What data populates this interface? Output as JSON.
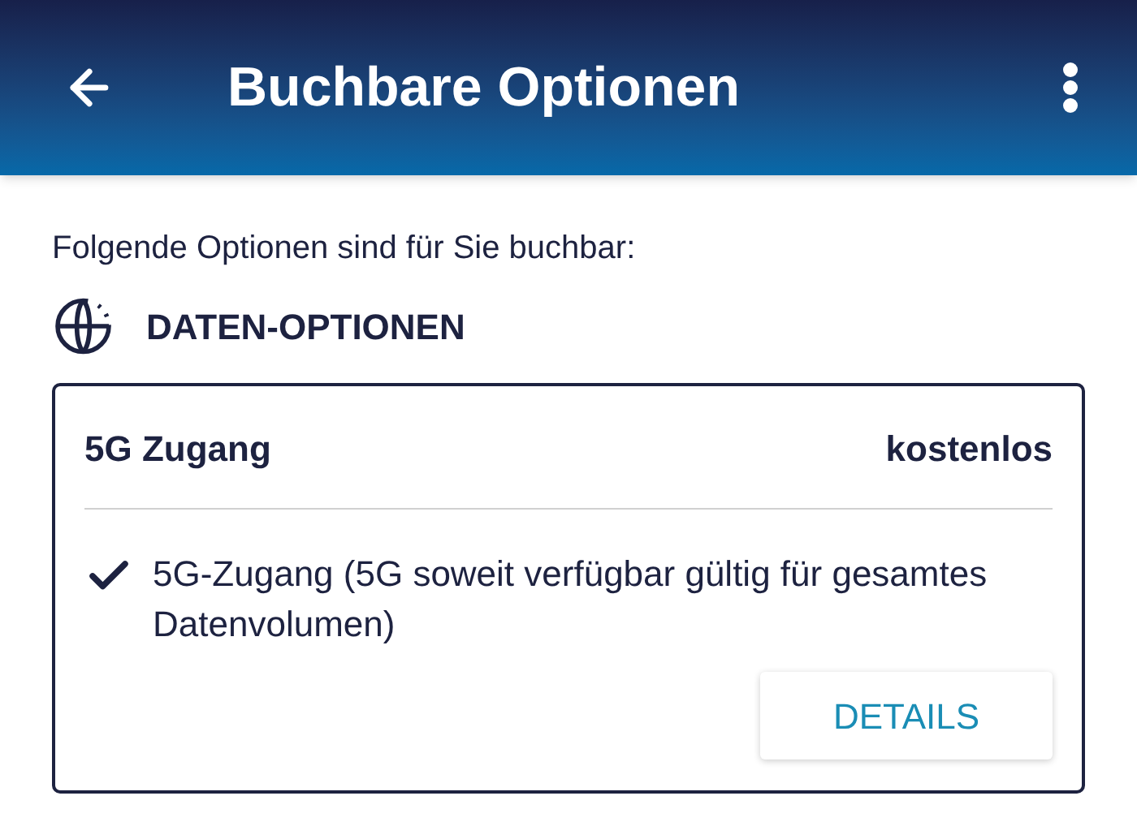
{
  "app_bar": {
    "title": "Buchbare Optionen"
  },
  "intro": "Folgende Optionen sind für Sie buchbar:",
  "section": {
    "title": "DATEN-OPTIONEN"
  },
  "options": [
    {
      "name": "5G Zugang",
      "price": "kostenlos",
      "features": [
        "5G-Zugang (5G soweit verfügbar gültig für gesamtes Datenvolumen)"
      ],
      "button": "DETAILS"
    }
  ]
}
